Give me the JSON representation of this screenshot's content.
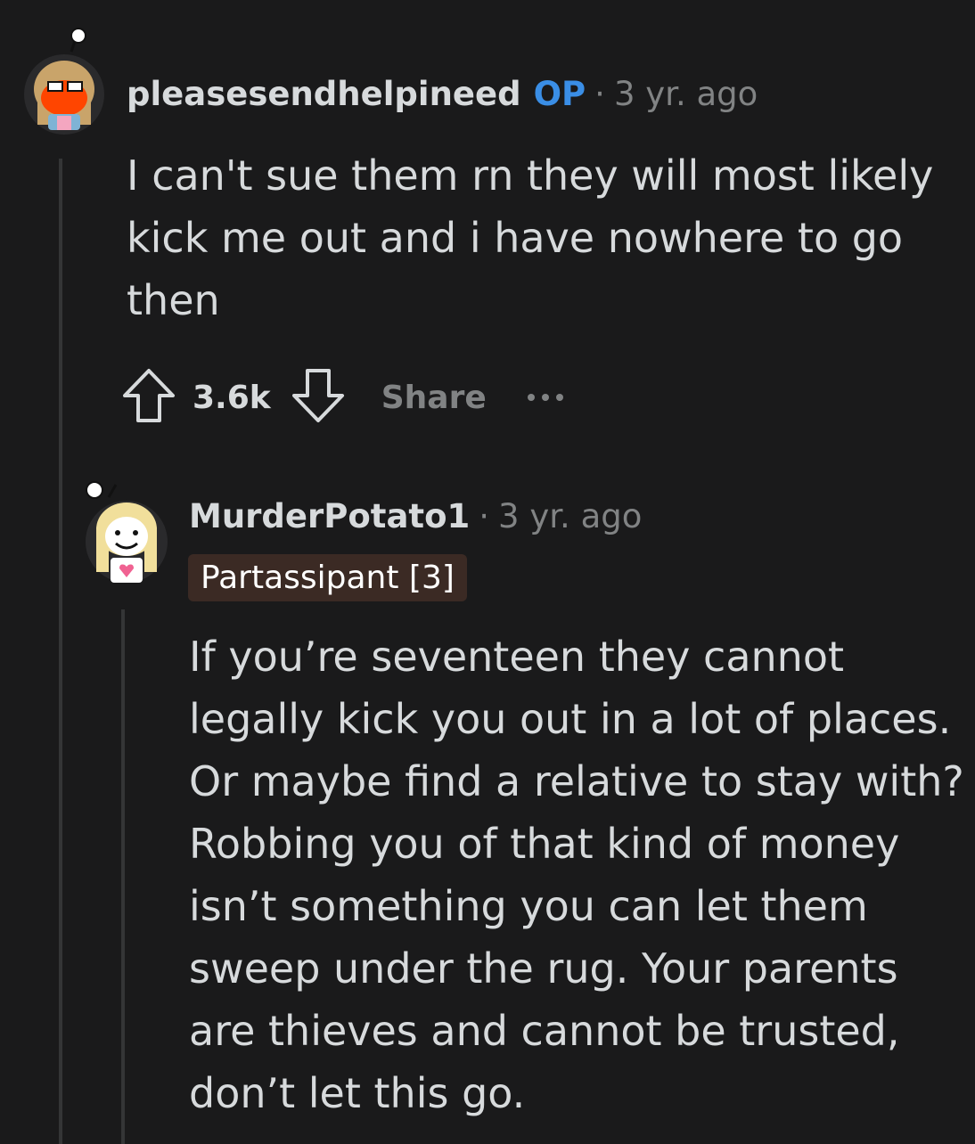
{
  "comments": [
    {
      "username": "pleasesendhelpineed",
      "op_badge": "OP",
      "separator": "·",
      "time": "3 yr. ago",
      "body_lines": [
        "I can't sue them rn they will most likely",
        "kick me out and i have nowhere to go",
        "then"
      ],
      "score": "3.6k",
      "share_label": "Share",
      "avatar_icon": "snoo-avatar-orange-glasses",
      "upvote_icon": "upvote-arrow-icon",
      "downvote_icon": "downvote-arrow-icon",
      "more_icon": "more-options-icon"
    },
    {
      "username": "MurderPotato1",
      "separator": "·",
      "time": "3 yr. ago",
      "flair": "Partassipant [3]",
      "body_lines": [
        "If you’re seventeen they cannot",
        "legally kick you out in a lot of places.",
        "Or maybe find a relative to stay with?",
        "Robbing you of that kind of money",
        "isn’t something you can let them",
        "sweep under the rug. Your parents",
        "are thieves and cannot be trusted,",
        "don’t let this go."
      ],
      "avatar_icon": "snoo-avatar-blonde-heart-shirt"
    }
  ],
  "colors": {
    "background": "#1a1a1b",
    "text": "#d7dadc",
    "muted": "#818384",
    "op_blue": "#3a8ee6",
    "flair_bg": "#3b2a24"
  }
}
